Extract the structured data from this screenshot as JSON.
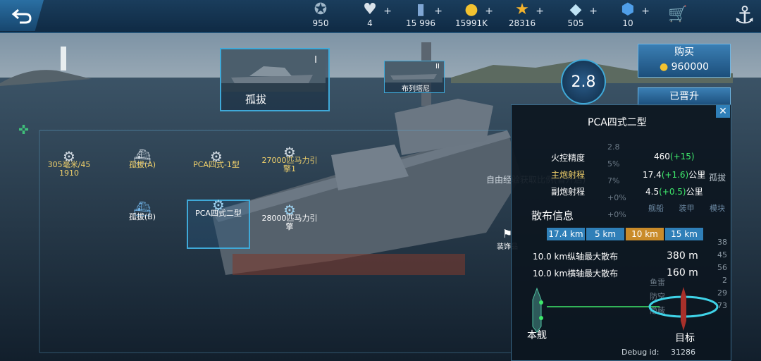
{
  "topbar": {
    "resources": [
      {
        "icon": "compass-icon",
        "value": "950",
        "plus": false
      },
      {
        "icon": "heart-icon",
        "value": "4",
        "plus": true
      },
      {
        "icon": "card-icon",
        "value": "15 996",
        "plus": true
      },
      {
        "icon": "gold-coin-icon",
        "value": "15991K",
        "plus": true
      },
      {
        "icon": "star-icon",
        "value": "28316",
        "plus": true
      },
      {
        "icon": "diamond-icon",
        "value": "505",
        "plus": true
      },
      {
        "icon": "crystal-icon",
        "value": "10",
        "plus": true
      }
    ]
  },
  "ship_cards": {
    "card1": {
      "name": "孤拔",
      "roman": "I"
    },
    "card2": {
      "name": "布列塔尼",
      "roman": "II"
    }
  },
  "items": [
    {
      "label": "305毫米/45\n1910"
    },
    {
      "label": "孤拔(A)"
    },
    {
      "label": "PCA四式-1型"
    },
    {
      "label": "27000匹马力引\n擎1"
    },
    {
      "label": "孤拔(B)"
    },
    {
      "label": "PCA四式二型"
    },
    {
      "label": "28000匹马力引\n擎"
    }
  ],
  "rating": "2.8",
  "buy": {
    "label": "购买",
    "price": "960000"
  },
  "promoted_label": "已晋升",
  "decor_label": "装饰品",
  "background_text": {
    "left_side": "自由经验获取比例(晋升后)",
    "right_name": "孤拔",
    "tabs": [
      "舰船",
      "装甲",
      "模块"
    ],
    "small_values": [
      "38",
      "45",
      "56",
      "2",
      "29",
      "73"
    ],
    "ghost_labels": [
      "鱼雷",
      "防空",
      "隐蔽"
    ],
    "ghost_values": [
      "2.8",
      "5%",
      "7%",
      "+0%",
      "+0%"
    ]
  },
  "panel": {
    "title": "PCA四式二型",
    "stats": [
      {
        "label": "火控精度",
        "base": "460",
        "delta": "(+15)",
        "unit": ""
      },
      {
        "label": "主炮射程",
        "base": "17.4",
        "delta": "(+1.6)",
        "unit": "公里"
      },
      {
        "label": "副炮射程",
        "base": "4.5",
        "delta": "(+0.5)",
        "unit": "公里"
      }
    ],
    "dispersion_title": "散布信息",
    "distances": [
      "17.4 km",
      "5 km",
      "10 km",
      "15 km"
    ],
    "dispersion_rows": [
      {
        "label": "10.0 km纵轴最大散布",
        "value": "380 m"
      },
      {
        "label": "10.0 km横轴最大散布",
        "value": "160 m"
      }
    ],
    "own_ship_label": "本舰",
    "target_label": "目标",
    "debug_label": "Debug id:",
    "debug_value": "31286"
  },
  "colors": {
    "accent": "#3fa9d8",
    "gold": "#f1d16b",
    "green": "#3ee86b",
    "orange": "#c98b2a"
  }
}
